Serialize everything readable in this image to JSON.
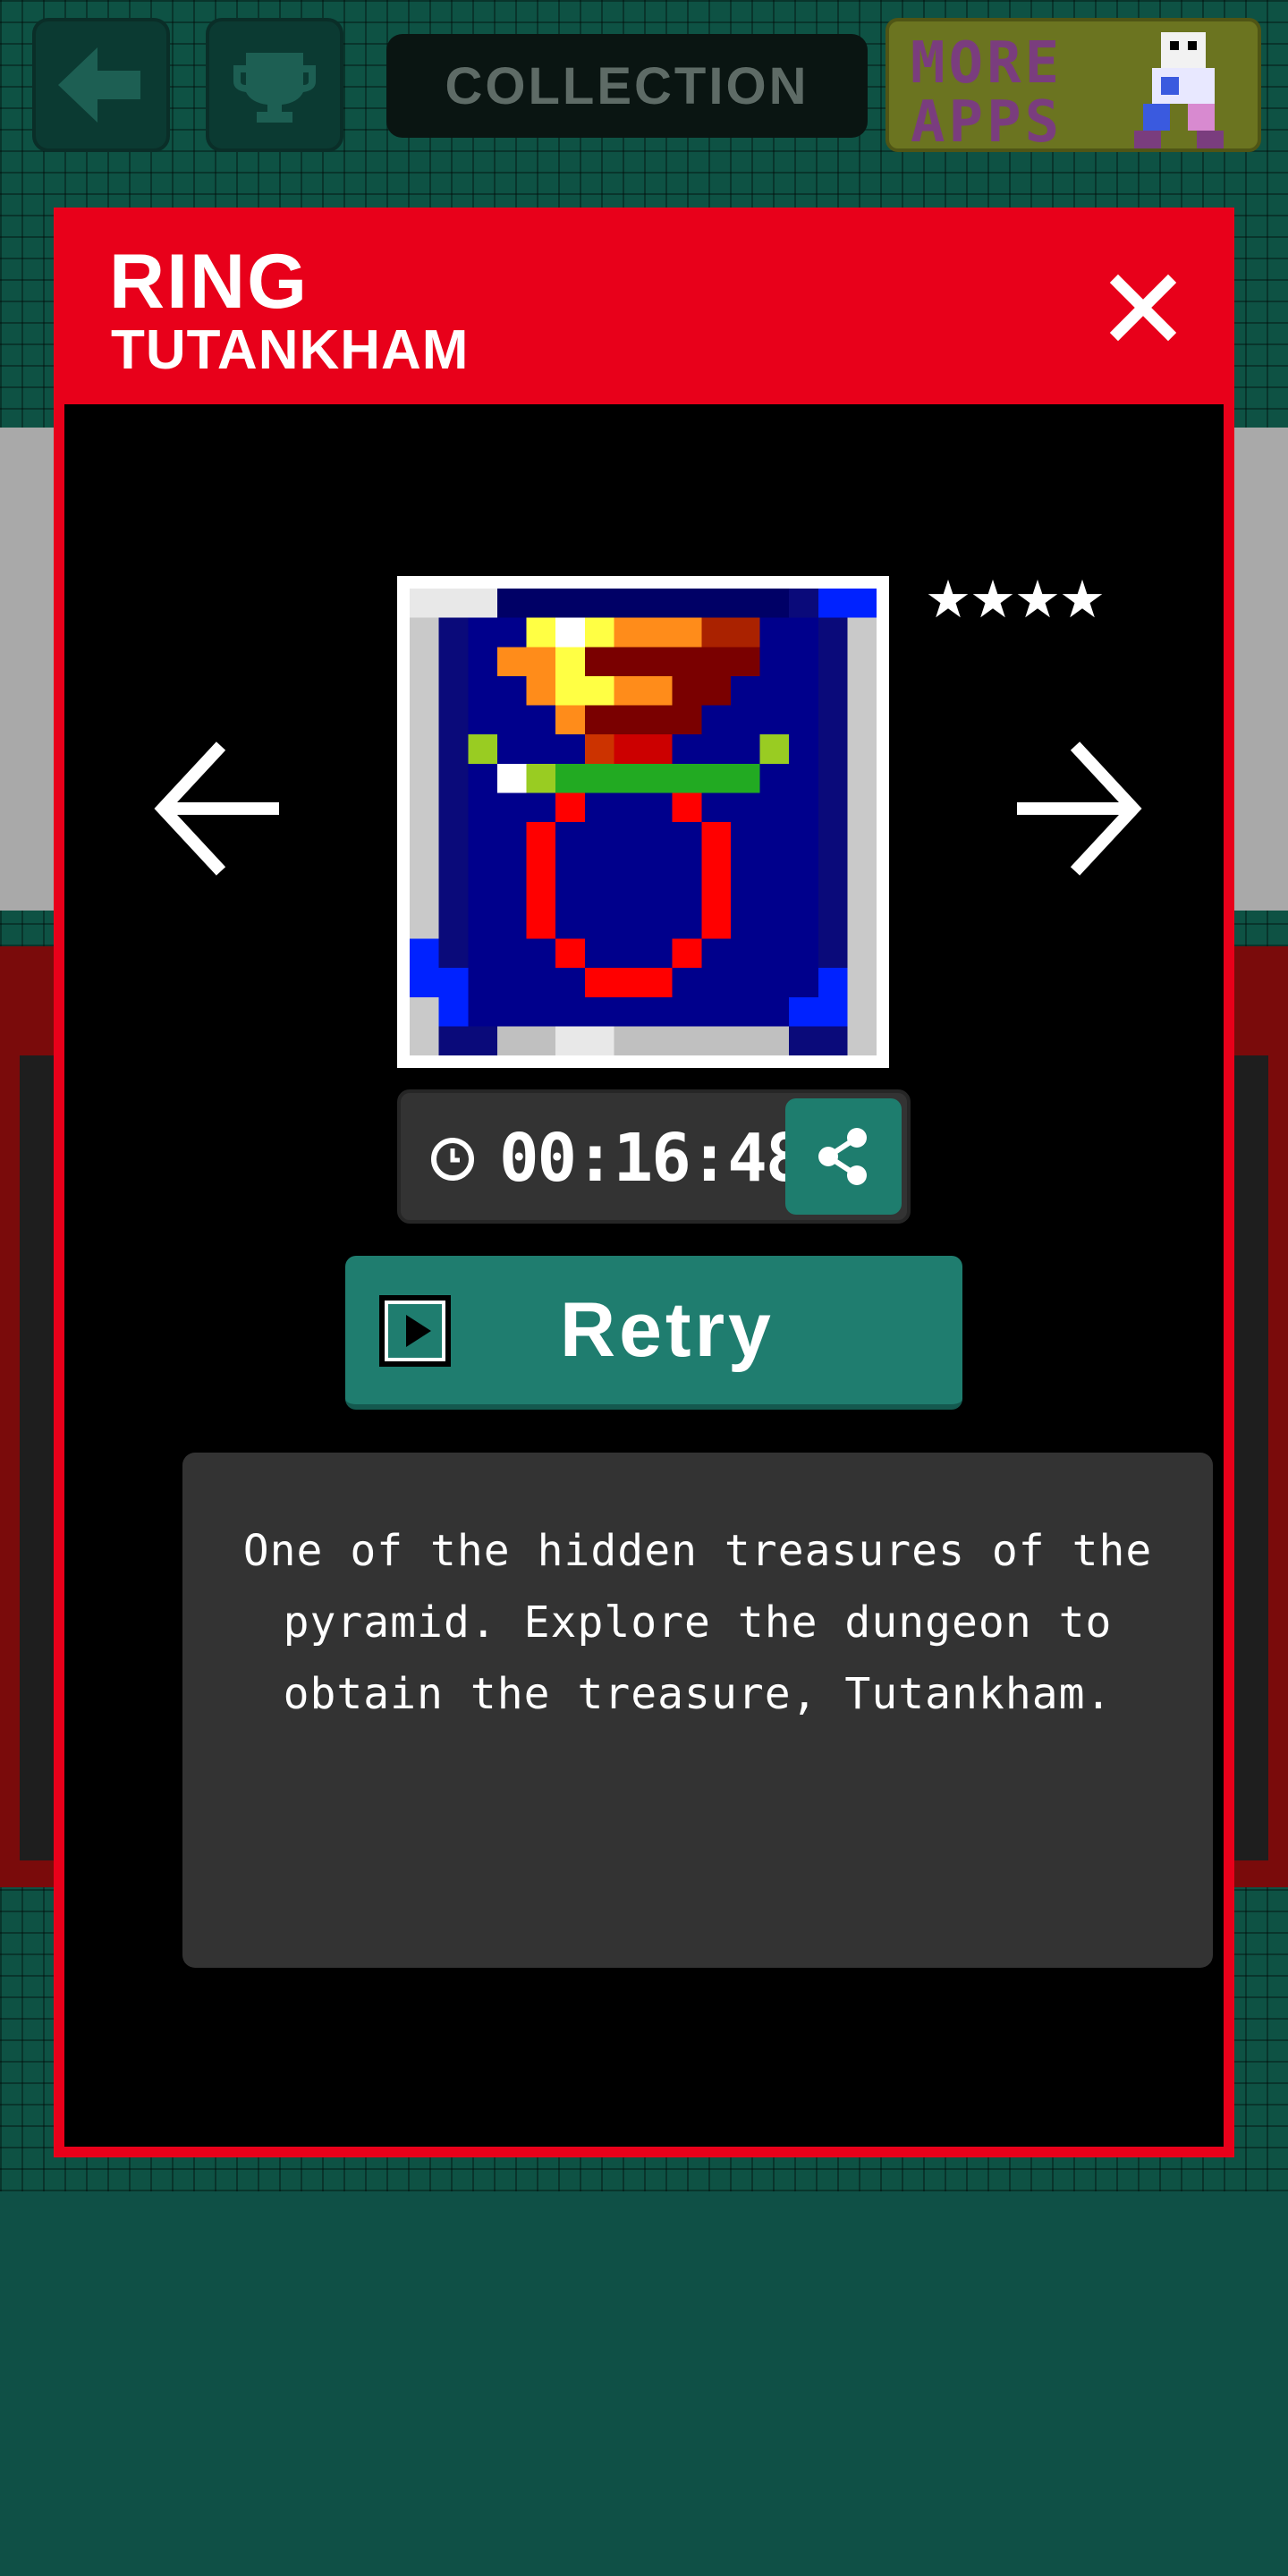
{
  "header": {
    "collection_label": "COLLECTION",
    "more_apps_label": "MORE APPS"
  },
  "modal": {
    "title": "RING",
    "subtitle": "TUTANKHAM",
    "stars": "★★★★",
    "rating": 4,
    "timer": "00:16:48",
    "retry_label": "Retry",
    "description": "One of the hidden treasures of the pyramid. Explore the dungeon to obtain the treasure, Tutankham."
  },
  "icons": [
    "back-arrow-icon",
    "trophy-icon",
    "close-icon",
    "prev-arrow-icon",
    "next-arrow-icon",
    "clock-icon",
    "share-icon",
    "play-icon"
  ],
  "colors": {
    "accent_red": "#e8001a",
    "teal_button": "#1f7d6f",
    "background_green": "#0e5244"
  }
}
